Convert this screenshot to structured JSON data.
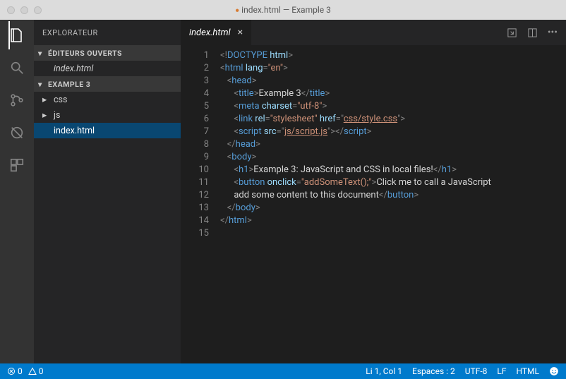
{
  "titlebar": {
    "filename": "index.html",
    "project": "Example 3",
    "modified_marker": "●"
  },
  "sidebar": {
    "title": "EXPLORATEUR",
    "open_editors_label": "ÉDITEURS OUVERTS",
    "open_editors": [
      {
        "name": "index.html"
      }
    ],
    "project_label": "EXAMPLE 3",
    "tree": [
      {
        "type": "folder",
        "name": "css"
      },
      {
        "type": "folder",
        "name": "js"
      },
      {
        "type": "file",
        "name": "index.html",
        "selected": true
      }
    ]
  },
  "tabs": [
    {
      "name": "index.html",
      "active": true
    }
  ],
  "code": {
    "lines": [
      "1",
      "2",
      "3",
      "4",
      "5",
      "6",
      "7",
      "8",
      "9",
      "10",
      "11",
      "12",
      "13",
      "14",
      "15"
    ],
    "tokens": [
      [
        {
          "c": "punc",
          "t": "<!"
        },
        {
          "c": "tag",
          "t": "DOCTYPE "
        },
        {
          "c": "attr",
          "t": "html"
        },
        {
          "c": "punc",
          "t": ">"
        }
      ],
      [
        {
          "c": "punc",
          "t": "<"
        },
        {
          "c": "tag",
          "t": "html "
        },
        {
          "c": "attr",
          "t": "lang"
        },
        {
          "c": "punc",
          "t": "="
        },
        {
          "c": "val",
          "t": "\"en\""
        },
        {
          "c": "punc",
          "t": ">"
        }
      ],
      [
        {
          "c": "txt",
          "t": "   "
        },
        {
          "c": "punc",
          "t": "<"
        },
        {
          "c": "tag",
          "t": "head"
        },
        {
          "c": "punc",
          "t": ">"
        }
      ],
      [
        {
          "c": "txt",
          "t": "      "
        },
        {
          "c": "punc",
          "t": "<"
        },
        {
          "c": "tag",
          "t": "title"
        },
        {
          "c": "punc",
          "t": ">"
        },
        {
          "c": "txt",
          "t": "Example 3"
        },
        {
          "c": "punc",
          "t": "</"
        },
        {
          "c": "tag",
          "t": "title"
        },
        {
          "c": "punc",
          "t": ">"
        }
      ],
      [
        {
          "c": "txt",
          "t": "      "
        },
        {
          "c": "punc",
          "t": "<"
        },
        {
          "c": "tag",
          "t": "meta "
        },
        {
          "c": "attr",
          "t": "charset"
        },
        {
          "c": "punc",
          "t": "="
        },
        {
          "c": "val",
          "t": "\"utf-8\""
        },
        {
          "c": "punc",
          "t": ">"
        }
      ],
      [
        {
          "c": "txt",
          "t": "      "
        },
        {
          "c": "punc",
          "t": "<"
        },
        {
          "c": "tag",
          "t": "link "
        },
        {
          "c": "attr",
          "t": "rel"
        },
        {
          "c": "punc",
          "t": "="
        },
        {
          "c": "val",
          "t": "\"stylesheet\""
        },
        {
          "c": "txt",
          "t": " "
        },
        {
          "c": "attr",
          "t": "href"
        },
        {
          "c": "punc",
          "t": "=\""
        },
        {
          "c": "link",
          "t": "css/style.css"
        },
        {
          "c": "punc",
          "t": "\">"
        }
      ],
      [
        {
          "c": "txt",
          "t": "      "
        },
        {
          "c": "punc",
          "t": "<"
        },
        {
          "c": "tag",
          "t": "script "
        },
        {
          "c": "attr",
          "t": "src"
        },
        {
          "c": "punc",
          "t": "=\""
        },
        {
          "c": "link",
          "t": "js/script.js"
        },
        {
          "c": "punc",
          "t": "\">"
        },
        {
          "c": "punc",
          "t": "</"
        },
        {
          "c": "tag",
          "t": "script"
        },
        {
          "c": "punc",
          "t": ">"
        }
      ],
      [
        {
          "c": "txt",
          "t": "   "
        },
        {
          "c": "punc",
          "t": "</"
        },
        {
          "c": "tag",
          "t": "head"
        },
        {
          "c": "punc",
          "t": ">"
        }
      ],
      [
        {
          "c": "txt",
          "t": "   "
        },
        {
          "c": "punc",
          "t": "<"
        },
        {
          "c": "tag",
          "t": "body"
        },
        {
          "c": "punc",
          "t": ">"
        }
      ],
      [
        {
          "c": "txt",
          "t": "      "
        },
        {
          "c": "punc",
          "t": "<"
        },
        {
          "c": "tag",
          "t": "h1"
        },
        {
          "c": "punc",
          "t": ">"
        },
        {
          "c": "txt",
          "t": "Example 3: JavaScript and CSS in local files!"
        },
        {
          "c": "punc",
          "t": "</"
        },
        {
          "c": "tag",
          "t": "h1"
        },
        {
          "c": "punc",
          "t": ">"
        }
      ],
      [
        {
          "c": "txt",
          "t": "      "
        },
        {
          "c": "punc",
          "t": "<"
        },
        {
          "c": "tag",
          "t": "button "
        },
        {
          "c": "attr",
          "t": "onclick"
        },
        {
          "c": "punc",
          "t": "="
        },
        {
          "c": "val",
          "t": "\"addSomeText();\""
        },
        {
          "c": "punc",
          "t": ">"
        },
        {
          "c": "txt",
          "t": "Click me to call a JavaScript"
        }
      ],
      [
        {
          "c": "txt",
          "t": "      add some content to this document"
        },
        {
          "c": "punc",
          "t": "</"
        },
        {
          "c": "tag",
          "t": "button"
        },
        {
          "c": "punc",
          "t": ">"
        }
      ],
      [
        {
          "c": "txt",
          "t": ""
        }
      ],
      [
        {
          "c": "txt",
          "t": "   "
        },
        {
          "c": "punc",
          "t": "</"
        },
        {
          "c": "tag",
          "t": "body"
        },
        {
          "c": "punc",
          "t": ">"
        }
      ],
      [
        {
          "c": "punc",
          "t": "</"
        },
        {
          "c": "tag",
          "t": "html"
        },
        {
          "c": "punc",
          "t": ">"
        }
      ]
    ]
  },
  "status": {
    "errors": "0",
    "warnings": "0",
    "cursor": "Li 1, Col 1",
    "spaces": "Espaces : 2",
    "encoding": "UTF-8",
    "eol": "LF",
    "lang": "HTML"
  }
}
